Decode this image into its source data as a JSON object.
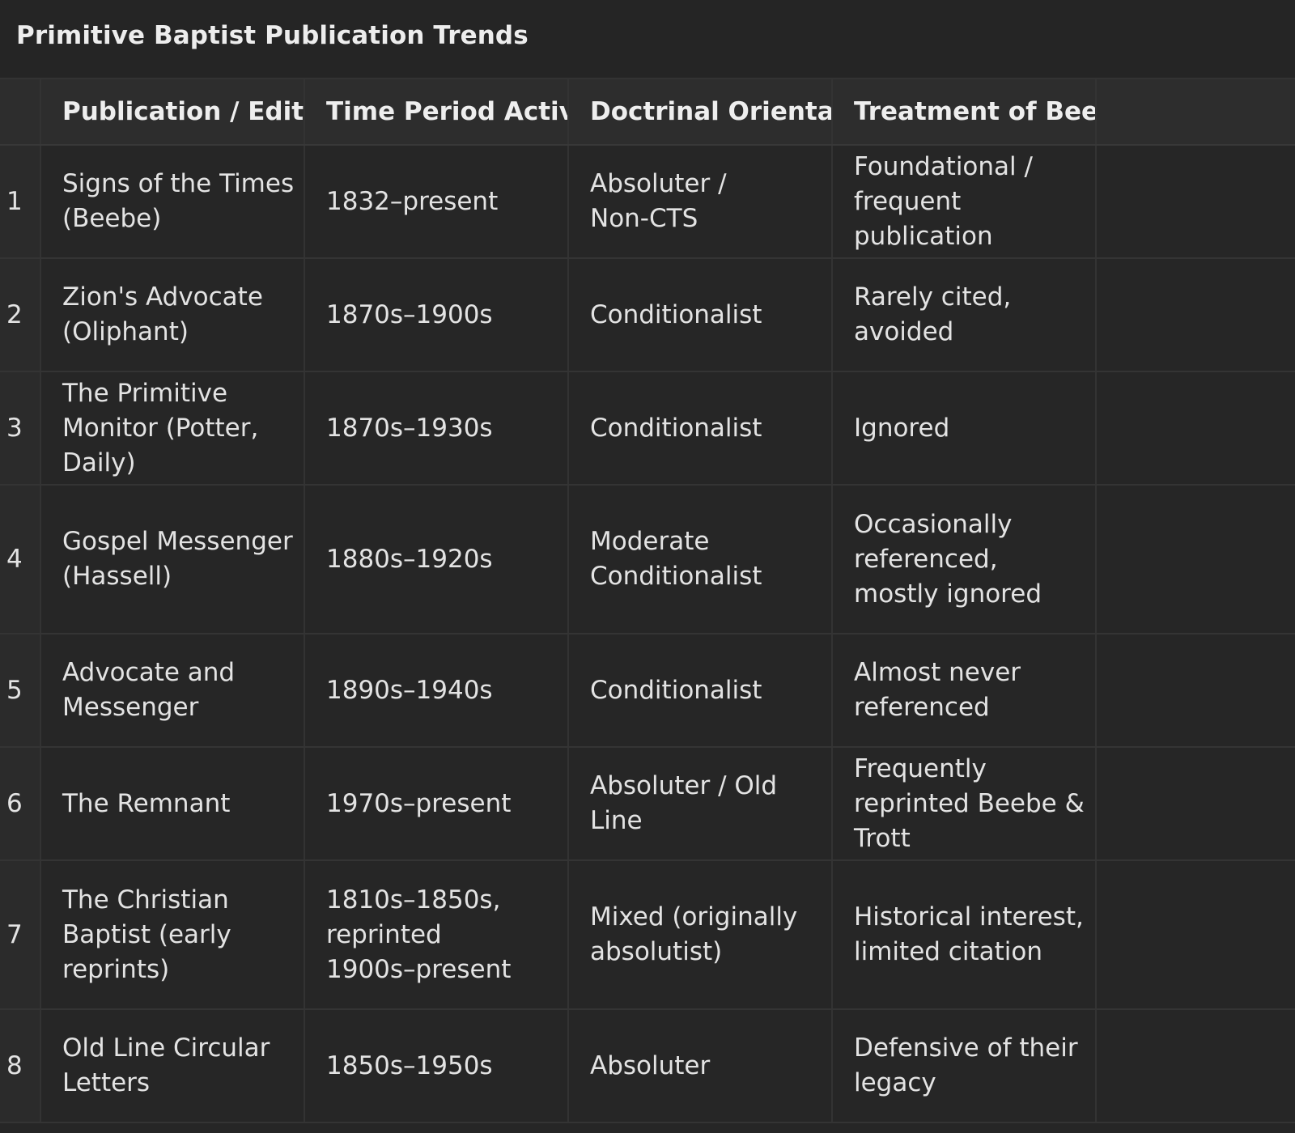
{
  "title": "Primitive Baptist Publication Trends",
  "table": {
    "headers": [
      "",
      "Publication / Editor",
      "Time Period Active",
      "Doctrinal Orientation",
      "Treatment of Beebe /",
      ""
    ],
    "rows": [
      {
        "num": "1",
        "publication": "Signs of the Times\n(Beebe)",
        "period": "1832–present",
        "orientation": "Absoluter /\nNon-CTS",
        "treatment": "Foundational /\nfrequent\npublication"
      },
      {
        "num": "2",
        "publication": "Zion's Advocate\n(Oliphant)",
        "period": "1870s–1900s",
        "orientation": "Conditionalist",
        "treatment": "Rarely cited,\navoided"
      },
      {
        "num": "3",
        "publication": "The Primitive\nMonitor (Potter,\nDaily)",
        "period": "1870s–1930s",
        "orientation": "Conditionalist",
        "treatment": "Ignored"
      },
      {
        "num": "4",
        "publication": "Gospel Messenger\n(Hassell)",
        "period": "1880s–1920s",
        "orientation": "Moderate\nConditionalist",
        "treatment": "Occasionally\nreferenced,\nmostly ignored"
      },
      {
        "num": "5",
        "publication": "Advocate and\nMessenger",
        "period": "1890s–1940s",
        "orientation": "Conditionalist",
        "treatment": "Almost never\nreferenced"
      },
      {
        "num": "6",
        "publication": "The Remnant",
        "period": "1970s–present",
        "orientation": "Absoluter / Old\nLine",
        "treatment": "Frequently\nreprinted Beebe &\nTrott"
      },
      {
        "num": "7",
        "publication": "The Christian\nBaptist (early\nreprints)",
        "period": "1810s–1850s,\nreprinted\n1900s–present",
        "orientation": "Mixed (originally\nabsolutist)",
        "treatment": "Historical interest,\nlimited citation"
      },
      {
        "num": "8",
        "publication": "Old Line Circular\nLetters",
        "period": "1850s–1950s",
        "orientation": "Absoluter",
        "treatment": "Defensive of their\nlegacy"
      }
    ]
  }
}
